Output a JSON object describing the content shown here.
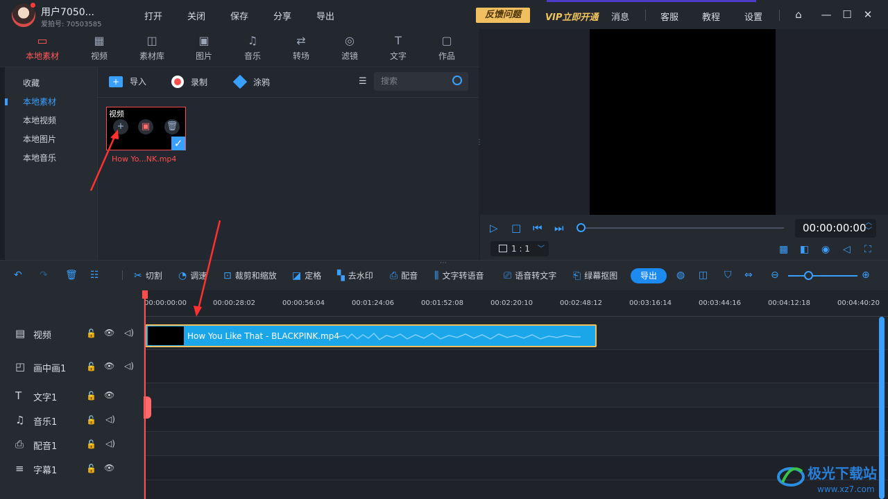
{
  "user": {
    "name": "用户7050...",
    "id": "爱拍号: 70503585"
  },
  "menu": [
    "打开",
    "关闭",
    "保存",
    "分享",
    "导出"
  ],
  "feedback": "反馈问题",
  "vip": "VIP立即开通",
  "top_links": [
    "消息",
    "客服",
    "教程",
    "设置"
  ],
  "media_tabs": [
    "本地素材",
    "视频",
    "素材库",
    "图片",
    "音乐",
    "转场",
    "滤镜",
    "文字",
    "作品"
  ],
  "sidebar": [
    "收藏",
    "本地素材",
    "本地视频",
    "本地图片",
    "本地音乐"
  ],
  "media_toolbar": {
    "import": "导入",
    "record": "录制",
    "doodle": "涂鸦",
    "search_placeholder": "搜索"
  },
  "media_item": {
    "label": "视频",
    "name": "How Yo...NK.mp4"
  },
  "player": {
    "timecode": "00:00:00:00",
    "ratio": "1 : 1"
  },
  "edit_tools": [
    "切割",
    "调速",
    "裁剪和缩放",
    "定格",
    "去水印",
    "配音",
    "文字转语音",
    "语音转文字",
    "绿幕抠图"
  ],
  "export_btn": "导出",
  "ruler_ticks": [
    "00:00:00:00",
    "00:00:28:02",
    "00:00:56:04",
    "00:01:24:06",
    "00:01:52:08",
    "00:02:20:10",
    "00:02:48:12",
    "00:03:16:14",
    "00:03:44:16",
    "00:04:12:18",
    "00:04:40:20"
  ],
  "tracks": [
    "视频",
    "画中画1",
    "文字1",
    "音乐1",
    "配音1",
    "字幕1"
  ],
  "clip": {
    "name": "How You Like That - BLACKPINK.mp4"
  },
  "watermark": {
    "brand": "极光下载站",
    "url": "www.xz7.com"
  }
}
